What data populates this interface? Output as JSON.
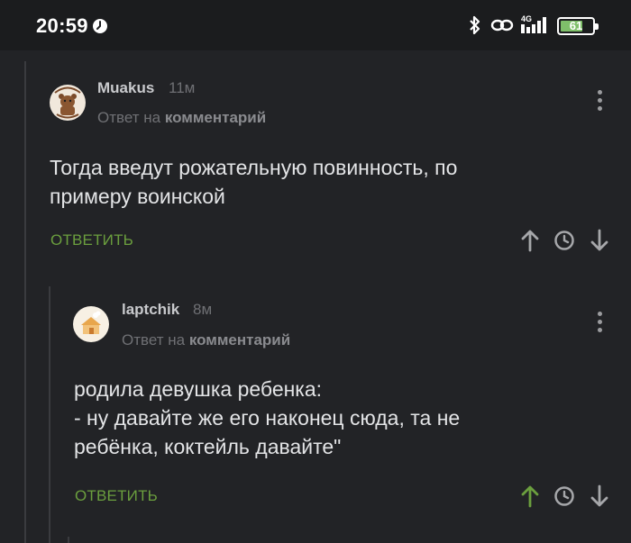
{
  "status_bar": {
    "time": "20:59",
    "network": "4G",
    "battery": "61",
    "icons": [
      "clock-icon",
      "bluetooth-icon",
      "link-icon",
      "signal-icon",
      "battery-icon"
    ]
  },
  "colors": {
    "background": "#222326",
    "reply_button": "#6b9f3e",
    "upvoted": "#6b9f3e",
    "muted_text": "#6f7074",
    "body_text": "#e3e4e6"
  },
  "comments": [
    {
      "username": "Muakus",
      "time_ago": "11м",
      "reply_prefix": "Ответ на",
      "reply_target": "комментарий",
      "text": "Тогда введут рожательную повинность, по\nпримеру воинской",
      "reply_button": "ОТВЕТИТЬ",
      "upvoted": false
    },
    {
      "username": "laptchik",
      "time_ago": "8м",
      "reply_prefix": "Ответ на",
      "reply_target": "комментарий",
      "text": "родила девушка ребенка:\n- ну давайте же его наконец сюда, та не\nребёнка, коктейль давайте\"",
      "reply_button": "ОТВЕТИТЬ",
      "upvoted": true
    }
  ]
}
